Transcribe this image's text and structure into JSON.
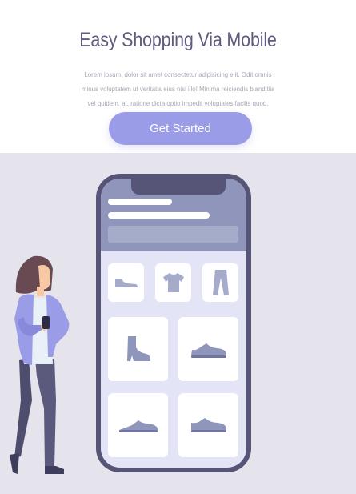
{
  "hero": {
    "title": "Easy Shopping Via Mobile",
    "description": "Lorem ipsum, dolor sit amet consectetur adipisicing elit. Odit omnis minus voluptatem ut veritatis eius nisi illo! Minima reiciendis blanditiis vel quidem, at, ratione dicta optio impedit voluptates facilis quod.",
    "cta_label": "Get Started"
  },
  "phone": {
    "categories": [
      {
        "icon": "flat-shoe-icon"
      },
      {
        "icon": "tshirt-icon"
      },
      {
        "icon": "pants-icon"
      }
    ],
    "products": [
      {
        "icon": "ankle-boot-icon"
      },
      {
        "icon": "sneaker-icon"
      },
      {
        "icon": "low-shoe-icon"
      },
      {
        "icon": "sneaker-icon"
      }
    ]
  },
  "colors": {
    "accent": "#9b9ce8",
    "title": "#5f5b7e",
    "phone_frame": "#565477",
    "screen_header": "#8f95bb",
    "stage_background": "#e5e4ec"
  }
}
